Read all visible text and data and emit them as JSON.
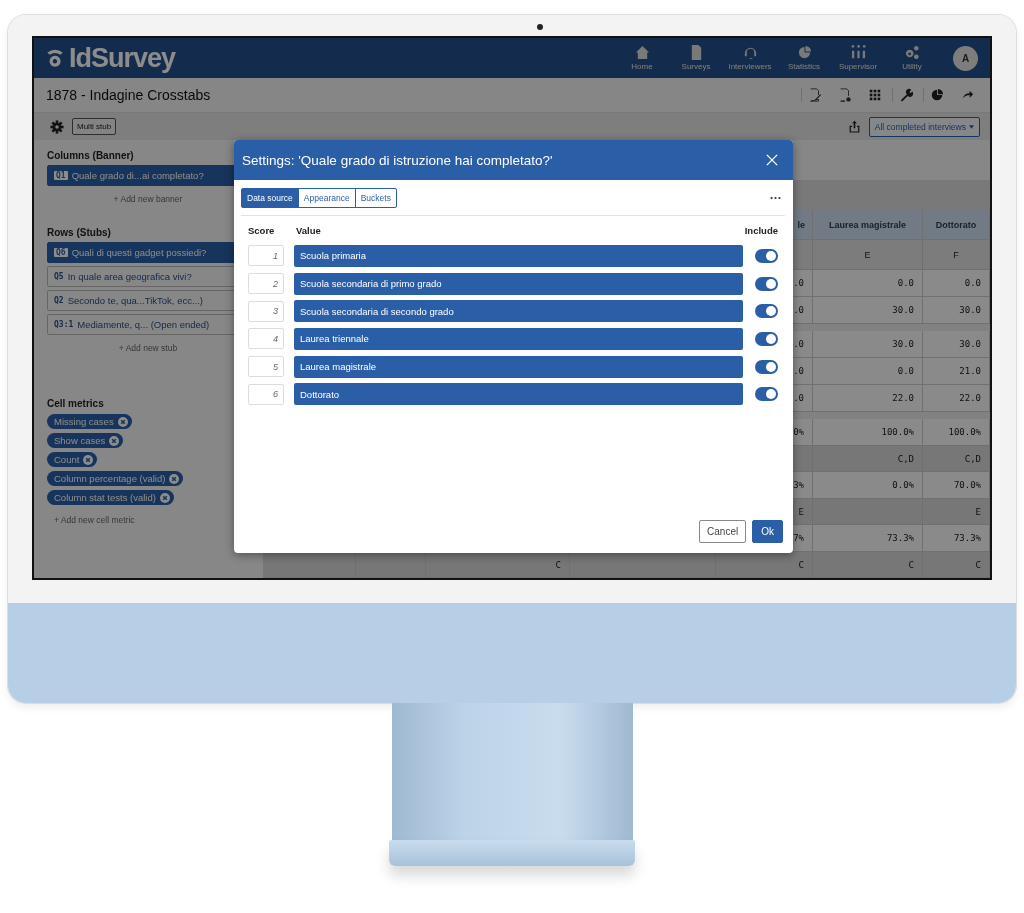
{
  "app": {
    "logo": "IdSurvey",
    "nav": [
      {
        "kind": "home",
        "label": "Home"
      },
      {
        "kind": "doc",
        "label": "Surveys"
      },
      {
        "kind": "headset",
        "label": "Interviewers"
      },
      {
        "kind": "pie",
        "label": "Statistics"
      },
      {
        "kind": "people",
        "label": "Supervisor"
      },
      {
        "kind": "gears",
        "label": "Utility"
      }
    ],
    "avatar": "A"
  },
  "page": {
    "title": "1878 - Indagine Crosstabs"
  },
  "toolbar": {
    "multi_stub": "Multi stub",
    "filter": "All completed interviews"
  },
  "sidebar": {
    "columns": {
      "heading": "Columns (Banner)",
      "items": [
        {
          "code": "Q1",
          "label": "Quale grado di...ai completato?",
          "selected": true
        }
      ],
      "add": "+ Add new banner"
    },
    "rows": {
      "heading": "Rows (Stubs)",
      "items": [
        {
          "code": "Q6",
          "label": "Quali di questi gadget possiedi?",
          "selected": true
        },
        {
          "code": "Q5",
          "label": "In quale area geografica vivi?",
          "selected": false
        },
        {
          "code": "Q2",
          "label": "Secondo te, qua...TikTok, ecc...)",
          "selected": false
        },
        {
          "code": "Q3:1",
          "label": "Mediamente, q... (Open ended)",
          "selected": false
        }
      ],
      "add": "+ Add new stub"
    },
    "cell_metrics": {
      "heading": "Cell metrics",
      "items": [
        "Missing cases",
        "Show cases",
        "Count",
        "Column percentage (valid)",
        "Column stat tests (valid)"
      ],
      "add": "+ Add new cell metric"
    }
  },
  "table": {
    "columns": [
      "le",
      "Laurea magistrale",
      "Dottorato"
    ],
    "rows": [
      {
        "kind": "letters",
        "e": "E",
        "f": "F"
      },
      {
        "kind": "value",
        "d": ".0",
        "e": "0.0",
        "f": "0.0"
      },
      {
        "kind": "value",
        "d": ".0",
        "e": "30.0",
        "f": "30.0"
      },
      {
        "kind": "spacer"
      },
      {
        "kind": "value",
        "d": ".0",
        "e": "30.0",
        "f": "30.0"
      },
      {
        "kind": "value",
        "d": ".0",
        "e": "0.0",
        "f": "21.0"
      },
      {
        "kind": "value",
        "d": ".0",
        "e": "22.0",
        "f": "22.0"
      },
      {
        "kind": "spacer"
      },
      {
        "kind": "value",
        "d": "0%",
        "e": "100.0%",
        "f": "100.0%"
      },
      {
        "kind": "test",
        "e": "C,D",
        "f": "C,D"
      },
      {
        "kind": "value",
        "d": "3%",
        "e": "0.0%",
        "f": "70.0%"
      },
      {
        "kind": "test",
        "d": "E",
        "f": "E"
      },
      {
        "kind": "value",
        "d": "7%",
        "e": "73.3%",
        "f": "73.3%"
      },
      {
        "kind": "test",
        "b": "C",
        "d": "C",
        "e": "C",
        "f": "C"
      }
    ]
  },
  "modal": {
    "title": "Settings: 'Quale grado di istruzione hai completato?'",
    "tabs": [
      {
        "label": "Data source",
        "selected": true
      },
      {
        "label": "Appearance",
        "selected": false
      },
      {
        "label": "Buckets",
        "selected": false
      }
    ],
    "headers": {
      "score": "Score",
      "value": "Value",
      "include": "Include"
    },
    "rows": [
      {
        "score": "1",
        "value": "Scuola primaria",
        "include": true
      },
      {
        "score": "2",
        "value": "Scuola secondaria di primo grado",
        "include": true
      },
      {
        "score": "3",
        "value": "Scuola secondaria di secondo grado",
        "include": true
      },
      {
        "score": "4",
        "value": "Laurea triennale",
        "include": true
      },
      {
        "score": "5",
        "value": "Laurea magistrale",
        "include": true
      },
      {
        "score": "6",
        "value": "Dottorato",
        "include": true
      }
    ],
    "buttons": {
      "cancel": "Cancel",
      "ok": "Ok"
    }
  }
}
